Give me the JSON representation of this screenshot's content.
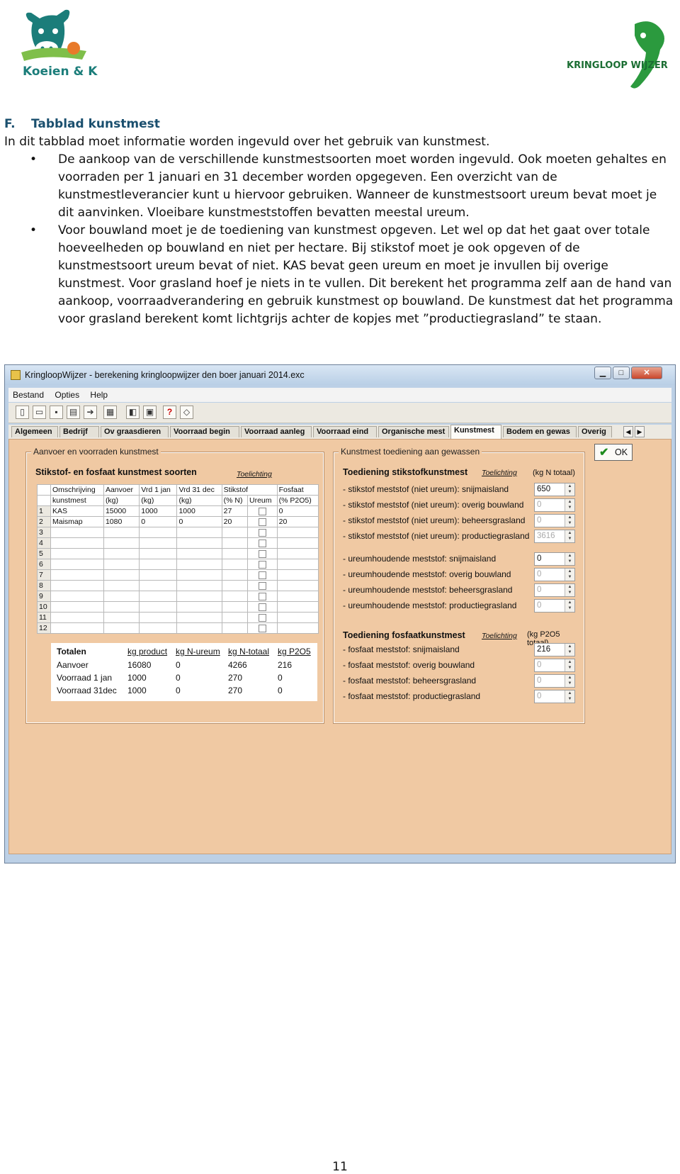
{
  "header": {
    "left_logo_text": "Koeien & Kansen",
    "right_logo_text": "KRINGLOOP WIJZER"
  },
  "document": {
    "section_num": "F.",
    "section_title": "Tabblad kunstmest",
    "intro": "In dit tabblad moet informatie worden ingevuld over het gebruik van kunstmest.",
    "bullets": [
      "De aankoop van de verschillende kunstmestsoorten moet worden ingevuld. Ook moeten gehaltes en voorraden per 1 januari en 31 december worden opgegeven. Een overzicht van de kunstmestleverancier kunt u hiervoor gebruiken. Wanneer de kunstmestsoort ureum bevat moet je dit aanvinken. Vloeibare kunstmeststoffen bevatten meestal ureum.",
      "Voor bouwland moet je de toediening van kunstmest opgeven. Let wel op dat het gaat over totale hoeveelheden op bouwland en niet per hectare. Bij stikstof moet je ook opgeven of de kunstmestsoort ureum bevat of niet. KAS bevat geen ureum en moet je invullen bij overige kunstmest. Voor grasland hoef je niets in te vullen. Dit berekent het programma zelf aan de hand van aankoop, voorraadverandering en gebruik kunstmest op bouwland. De kunstmest dat het programma voor grasland berekent komt lichtgrijs achter de kopjes met ”productiegrasland” te staan."
    ],
    "page_number": "11"
  },
  "window": {
    "title": "KringloopWijzer - berekening kringloopwijzer den boer januari 2014.exc",
    "menu": [
      "Bestand",
      "Opties",
      "Help"
    ],
    "toolbar_icons": [
      "new-icon",
      "open-icon",
      "save-icon",
      "print-preview-icon",
      "export-icon",
      "calculator-icon",
      "report-icon",
      "printer-icon",
      "help-icon",
      "eraser-icon"
    ],
    "tabs": [
      "Algemeen",
      "Bedrijf",
      "Ov graasdieren",
      "Voorraad begin",
      "Voorraad aanleg",
      "Voorraad eind",
      "Organische mest",
      "Kunstmest",
      "Bodem en gewas",
      "Overig"
    ],
    "active_tab": "Kunstmest",
    "ok_label": "OK"
  },
  "left_group": {
    "label": "Aanvoer en voorraden kunstmest",
    "heading": "Stikstof- en fosfaat kunstmest soorten",
    "help_link": "Toelichting",
    "col_headers_1": [
      "Omschrijving",
      "Aanvoer",
      "Vrd 1 jan",
      "Vrd 31 dec",
      "Stikstof",
      "Fosfaat"
    ],
    "col_headers_2": [
      "kunstmest",
      "(kg)",
      "(kg)",
      "(kg)",
      "(% N)",
      "Ureum",
      "(% P2O5)"
    ],
    "rows": [
      {
        "n": "1",
        "name": "KAS",
        "aanvoer": "15000",
        "vrd1": "1000",
        "vrd31": "1000",
        "n_pct": "27",
        "p": "0"
      },
      {
        "n": "2",
        "name": "Maismap",
        "aanvoer": "1080",
        "vrd1": "0",
        "vrd31": "0",
        "n_pct": "20",
        "p": "20"
      },
      {
        "n": "3",
        "name": "",
        "aanvoer": "",
        "vrd1": "",
        "vrd31": "",
        "n_pct": "",
        "p": ""
      },
      {
        "n": "4",
        "name": "",
        "aanvoer": "",
        "vrd1": "",
        "vrd31": "",
        "n_pct": "",
        "p": ""
      },
      {
        "n": "5",
        "name": "",
        "aanvoer": "",
        "vrd1": "",
        "vrd31": "",
        "n_pct": "",
        "p": ""
      },
      {
        "n": "6",
        "name": "",
        "aanvoer": "",
        "vrd1": "",
        "vrd31": "",
        "n_pct": "",
        "p": ""
      },
      {
        "n": "7",
        "name": "",
        "aanvoer": "",
        "vrd1": "",
        "vrd31": "",
        "n_pct": "",
        "p": ""
      },
      {
        "n": "8",
        "name": "",
        "aanvoer": "",
        "vrd1": "",
        "vrd31": "",
        "n_pct": "",
        "p": ""
      },
      {
        "n": "9",
        "name": "",
        "aanvoer": "",
        "vrd1": "",
        "vrd31": "",
        "n_pct": "",
        "p": ""
      },
      {
        "n": "10",
        "name": "",
        "aanvoer": "",
        "vrd1": "",
        "vrd31": "",
        "n_pct": "",
        "p": ""
      },
      {
        "n": "11",
        "name": "",
        "aanvoer": "",
        "vrd1": "",
        "vrd31": "",
        "n_pct": "",
        "p": ""
      },
      {
        "n": "12",
        "name": "",
        "aanvoer": "",
        "vrd1": "",
        "vrd31": "",
        "n_pct": "",
        "p": ""
      }
    ],
    "totals": {
      "headers": [
        "Totalen",
        "kg product",
        "kg N-ureum",
        "kg N-totaal",
        "kg P2O5"
      ],
      "rows": [
        [
          "Aanvoer",
          "16080",
          "0",
          "4266",
          "216"
        ],
        [
          "Voorraad 1 jan",
          "1000",
          "0",
          "270",
          "0"
        ],
        [
          "Voorraad 31dec",
          "1000",
          "0",
          "270",
          "0"
        ]
      ]
    }
  },
  "right_group": {
    "label": "Kunstmest toediening aan gewassen",
    "n_heading": "Toediening stikstofkunstmest",
    "n_link": "Toelichting",
    "n_unit": "(kg N totaal)",
    "n_rows": [
      {
        "label": "- stikstof meststof (niet ureum): snijmaisland",
        "value": "650",
        "dim": false
      },
      {
        "label": "- stikstof meststof (niet ureum): overig bouwland",
        "value": "0",
        "dim": true
      },
      {
        "label": "- stikstof meststof (niet ureum): beheersgrasland",
        "value": "0",
        "dim": true
      },
      {
        "label": "- stikstof meststof (niet ureum): productiegrasland",
        "value": "3616",
        "dim": true
      },
      {
        "label": "- ureumhoudende meststof: snijmaisland",
        "value": "0",
        "dim": false
      },
      {
        "label": "- ureumhoudende meststof: overig bouwland",
        "value": "0",
        "dim": true
      },
      {
        "label": "- ureumhoudende meststof: beheersgrasland",
        "value": "0",
        "dim": true
      },
      {
        "label": "- ureumhoudende meststof: productiegrasland",
        "value": "0",
        "dim": true
      }
    ],
    "p_heading": "Toediening fosfaatkunstmest",
    "p_link": "Toelichting",
    "p_unit": "(kg P2O5 totaal)",
    "p_rows": [
      {
        "label": "- fosfaat meststof: snijmaisland",
        "value": "216",
        "dim": false
      },
      {
        "label": "- fosfaat meststof: overig bouwland",
        "value": "0",
        "dim": true
      },
      {
        "label": "- fosfaat meststof: beheersgrasland",
        "value": "0",
        "dim": true
      },
      {
        "label": "- fosfaat meststof: productiegrasland",
        "value": "0",
        "dim": true
      }
    ]
  },
  "colors": {
    "heading_blue": "#1a4f6e",
    "panel_bg": "#f0c9a3",
    "logo_teal": "#1b7d7a",
    "logo_green": "#2b9a3e"
  }
}
